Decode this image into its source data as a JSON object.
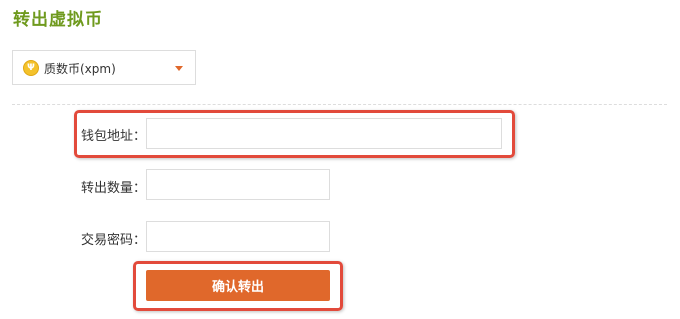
{
  "page": {
    "title": "转出虚拟币"
  },
  "currency_select": {
    "icon": "coin-icon",
    "icon_glyph": "Ψ",
    "selected": "质数币(xpm)"
  },
  "form": {
    "wallet_address": {
      "label": "钱包地址：",
      "value": "",
      "placeholder": ""
    },
    "amount": {
      "label": "转出数量：",
      "value": "",
      "placeholder": ""
    },
    "trade_password": {
      "label": "交易密码：",
      "value": "",
      "placeholder": ""
    },
    "confirm_label": "确认转出"
  },
  "colors": {
    "title": "#6f9a1e",
    "accent": "#e0682b",
    "highlight": "#e24a3b",
    "coin": "#f4c22b"
  }
}
